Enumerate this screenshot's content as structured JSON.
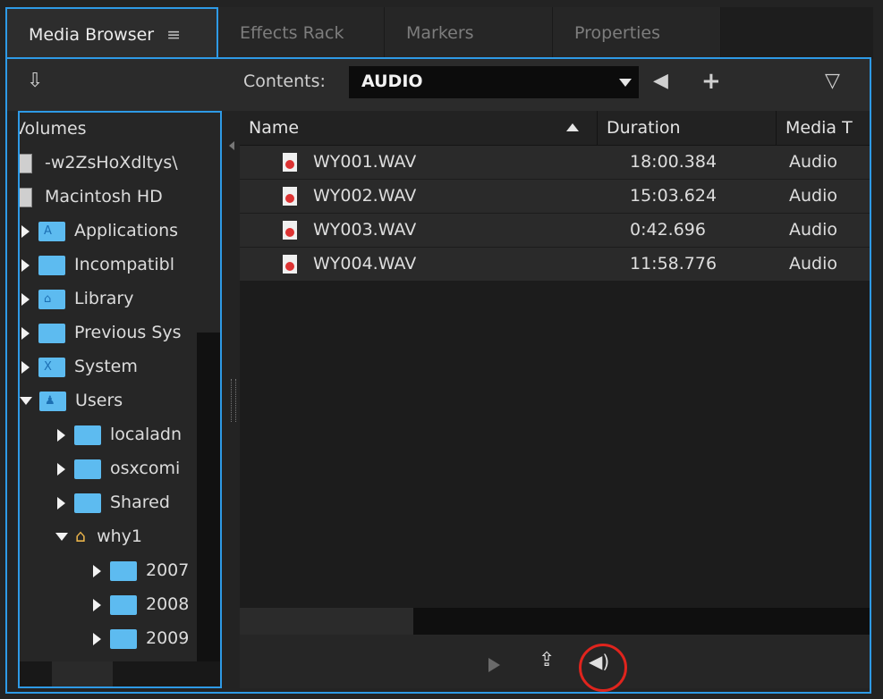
{
  "tabs": [
    {
      "label": "Media Browser",
      "menu_icon": "≡",
      "active": true
    },
    {
      "label": "Effects Rack",
      "active": false
    },
    {
      "label": "Markers",
      "active": false
    },
    {
      "label": "Properties",
      "active": false
    }
  ],
  "toolbar": {
    "contents_label": "Contents:",
    "contents_value": "AUDIO"
  },
  "tree": {
    "header": "Volumes",
    "items": [
      {
        "label": "-w2ZsHoXdltys\\",
        "type": "disk"
      },
      {
        "label": "Macintosh HD",
        "type": "disk"
      },
      {
        "label": "Applications",
        "type": "folder",
        "icon": "apps-folder-icon",
        "glyph": "A"
      },
      {
        "label": "Incompatibl",
        "type": "folder"
      },
      {
        "label": "Library",
        "type": "folder",
        "glyph": "⌂"
      },
      {
        "label": "Previous Sys",
        "type": "folder"
      },
      {
        "label": "System",
        "type": "folder",
        "glyph": "X"
      },
      {
        "label": "Users",
        "type": "folder",
        "glyph": "♟"
      },
      {
        "label": "localadn",
        "type": "folder"
      },
      {
        "label": "osxcomi",
        "type": "folder"
      },
      {
        "label": "Shared",
        "type": "folder"
      },
      {
        "label": "why1",
        "type": "home"
      },
      {
        "label": "2007",
        "type": "folder"
      },
      {
        "label": "2008",
        "type": "folder"
      },
      {
        "label": "2009",
        "type": "folder"
      }
    ]
  },
  "list": {
    "columns": [
      "Name",
      "Duration",
      "Media T"
    ],
    "rows": [
      {
        "name": "WY001.WAV",
        "duration": "18:00.384",
        "media_type": "Audio"
      },
      {
        "name": "WY002.WAV",
        "duration": "15:03.624",
        "media_type": "Audio"
      },
      {
        "name": "WY003.WAV",
        "duration": "0:42.696",
        "media_type": "Audio"
      },
      {
        "name": "WY004.WAV",
        "duration": "11:58.776",
        "media_type": "Audio"
      }
    ]
  },
  "colors": {
    "accent": "#2e9ae6",
    "highlight_ring": "#e0241d"
  }
}
